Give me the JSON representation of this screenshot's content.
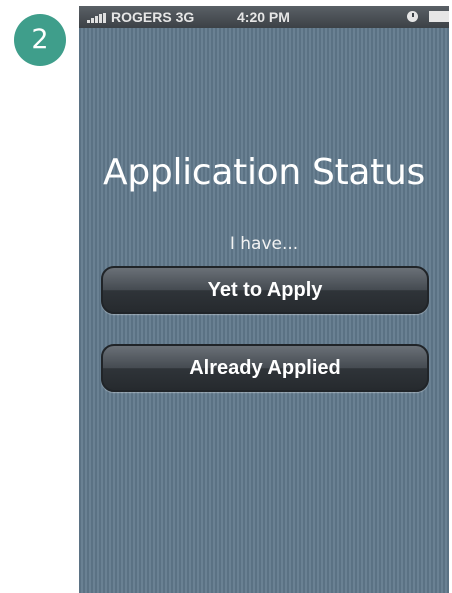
{
  "step_badge": "2",
  "status_bar": {
    "carrier": "ROGERS 3G",
    "time": "4:20 PM",
    "signal_icon": "signal-bars-icon",
    "alarm_icon": "alarm-clock-icon",
    "battery_icon": "battery-icon"
  },
  "screen": {
    "title": "Application Status",
    "prompt": "I have...",
    "buttons": [
      {
        "label": "Yet to Apply"
      },
      {
        "label": "Already Applied"
      }
    ]
  },
  "colors": {
    "badge": "#3f9e8b",
    "background": "#5d7486",
    "button": "#2f3439"
  }
}
